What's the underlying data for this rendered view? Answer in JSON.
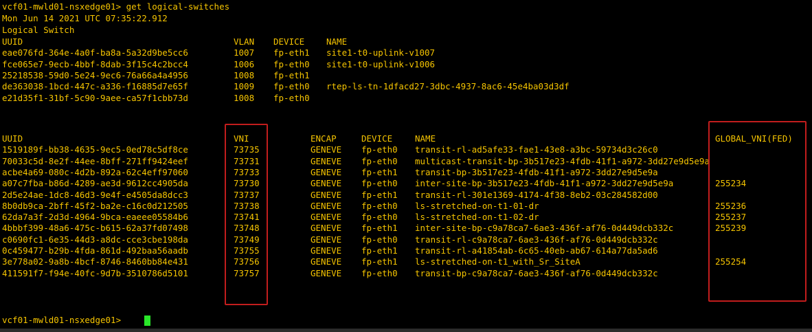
{
  "header": {
    "prompt_cmd": "vcf01-mwld01-nsxedge01> get logical-switches",
    "timestamp": "Mon Jun 14 2021 UTC 07:35:22.912",
    "section_title": "Logical Switch"
  },
  "table1": {
    "columns": [
      "UUID",
      "VLAN",
      "DEVICE",
      "NAME"
    ],
    "rows": [
      [
        "eae076fd-364e-4a0f-ba8a-5a32d9be5cc6",
        "1007",
        "fp-eth1",
        "site1-t0-uplink-v1007"
      ],
      [
        "fce065e7-9ecb-4bbf-8dab-3f15c4c2bcc4",
        "1006",
        "fp-eth0",
        "site1-t0-uplink-v1006"
      ],
      [
        "25218538-59d0-5e24-9ec6-76a66a4a4956",
        "1008",
        "fp-eth1",
        ""
      ],
      [
        "de363038-1bcd-447c-a336-f16885d7e65f",
        "1009",
        "fp-eth0",
        "rtep-ls-tn-1dfacd27-3dbc-4937-8ac6-45e4ba03d3df"
      ],
      [
        "e21d35f1-31bf-5c90-9aee-ca57f1cbb73d",
        "1008",
        "fp-eth0",
        ""
      ]
    ]
  },
  "table2": {
    "columns": [
      "UUID",
      "VNI",
      "ENCAP",
      "DEVICE",
      "NAME",
      "GLOBAL_VNI(FED)"
    ],
    "rows": [
      [
        "1519189f-bb38-4635-9ec5-0ed78c5df8ce",
        "73735",
        "GENEVE",
        "fp-eth0",
        "transit-rl-ad5afe33-fae1-43e8-a3bc-59734d3c26c0",
        ""
      ],
      [
        "70033c5d-8e2f-44ee-8bff-271ff9424eef",
        "73731",
        "GENEVE",
        "fp-eth0",
        "multicast-transit-bp-3b517e23-4fdb-41f1-a972-3dd27e9d5e9a",
        ""
      ],
      [
        "acbe4a69-080c-4d2b-892a-62c4eff97060",
        "73733",
        "GENEVE",
        "fp-eth1",
        "transit-bp-3b517e23-4fdb-41f1-a972-3dd27e9d5e9a",
        ""
      ],
      [
        "a07c7fba-b86d-4289-ae3d-9612cc4905da",
        "73730",
        "GENEVE",
        "fp-eth0",
        "inter-site-bp-3b517e23-4fdb-41f1-a972-3dd27e9d5e9a",
        "255234"
      ],
      [
        "2d5e24ae-1dc8-46d3-9e4f-e4505da8dcc3",
        "73737",
        "GENEVE",
        "fp-eth1",
        "transit-rl-301e1369-4174-4f38-8eb2-03c284582d00",
        ""
      ],
      [
        "8b0db9ca-2bff-45f2-ba2e-c16c0d212505",
        "73738",
        "GENEVE",
        "fp-eth0",
        "ls-stretched-on-t1-01-dr",
        "255236"
      ],
      [
        "62da7a3f-2d3d-4964-9bca-eaeee05584b6",
        "73741",
        "GENEVE",
        "fp-eth0",
        "ls-stretched-on-t1-02-dr",
        "255237"
      ],
      [
        "4bbbf399-48a6-475c-b615-62a37fd07498",
        "73748",
        "GENEVE",
        "fp-eth1",
        "inter-site-bp-c9a78ca7-6ae3-436f-af76-0d449dcb332c",
        "255239"
      ],
      [
        "c0690fc1-6e35-44d3-a8dc-cce3cbe198da",
        "73749",
        "GENEVE",
        "fp-eth0",
        "transit-rl-c9a78ca7-6ae3-436f-af76-0d449dcb332c",
        ""
      ],
      [
        "0c459477-b29b-4fda-861d-492baa56aadb",
        "73755",
        "GENEVE",
        "fp-eth1",
        "transit-rl-a41854ab-6c65-40eb-ab67-614a77da5ad6",
        ""
      ],
      [
        "3e778a02-9a8b-4bcf-8746-8460bb84e431",
        "73756",
        "GENEVE",
        "fp-eth1",
        "ls-stretched-on-t1_with_Sr_SiteA",
        "255254"
      ],
      [
        "411591f7-f94e-40fc-9d7b-3510786d5101",
        "73757",
        "GENEVE",
        "fp-eth0",
        "transit-bp-c9a78ca7-6ae3-436f-af76-0d449dcb332c",
        ""
      ]
    ]
  },
  "footer": {
    "prompt": "vcf01-mwld01-nsxedge01> "
  },
  "colors": {
    "background": "#000000",
    "text": "#f5c400",
    "highlight_box": "#c21d1d",
    "cursor": "#29e629"
  }
}
